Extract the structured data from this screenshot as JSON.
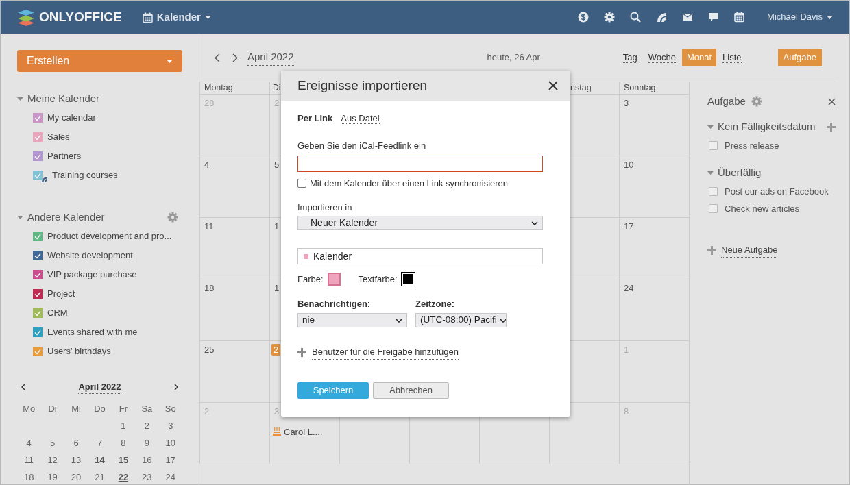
{
  "header": {
    "logo": "ONLYOFFICE",
    "module": "Kalender",
    "user": "Michael Davis"
  },
  "sidebar": {
    "create_button": "Erstellen",
    "sections": [
      {
        "title": "Meine Kalender",
        "expanded": true,
        "has_settings": false,
        "items": [
          {
            "label": "My calendar",
            "color": "#c994c7",
            "checked": true,
            "subscribed": false
          },
          {
            "label": "Sales",
            "color": "#e6a6bb",
            "checked": true,
            "subscribed": false
          },
          {
            "label": "Partners",
            "color": "#b396cf",
            "checked": true,
            "subscribed": false
          },
          {
            "label": "Training courses",
            "color": "#80c2d6",
            "checked": true,
            "subscribed": true
          }
        ]
      },
      {
        "title": "Andere Kalender",
        "expanded": true,
        "has_settings": true,
        "items": [
          {
            "label": "Product development and pro...",
            "color": "#5fb883",
            "checked": true,
            "subscribed": false
          },
          {
            "label": "Website development",
            "color": "#3f6899",
            "checked": true,
            "subscribed": false
          },
          {
            "label": "VIP package purchase",
            "color": "#cc4c90",
            "checked": true,
            "subscribed": false
          },
          {
            "label": "Project",
            "color": "#c02a50",
            "checked": true,
            "subscribed": false
          },
          {
            "label": "CRM",
            "color": "#a0bb5c",
            "checked": true,
            "subscribed": false
          },
          {
            "label": "Events shared with me",
            "color": "#2f9fc1",
            "checked": true,
            "subscribed": false
          },
          {
            "label": "Users' birthdays",
            "color": "#e89b3d",
            "checked": true,
            "subscribed": false
          }
        ]
      }
    ]
  },
  "mini_calendar": {
    "title": "April 2022",
    "weekdays": [
      "Mo",
      "Di",
      "Mi",
      "Do",
      "Fr",
      "Sa",
      "So"
    ],
    "weeks": [
      [
        {
          "day": "1",
          "has_events": false
        },
        {
          "day": "2",
          "has_events": false
        },
        {
          "day": "3",
          "has_events": false
        }
      ],
      [
        {
          "day": "4",
          "has_events": false
        },
        {
          "day": "5",
          "has_events": false
        },
        {
          "day": "6",
          "has_events": false
        },
        {
          "day": "7",
          "has_events": false
        },
        {
          "day": "8",
          "has_events": false
        },
        {
          "day": "9",
          "has_events": false
        },
        {
          "day": "10",
          "has_events": false
        }
      ],
      [
        {
          "day": "11",
          "has_events": false
        },
        {
          "day": "12",
          "has_events": false
        },
        {
          "day": "13",
          "has_events": false
        },
        {
          "day": "14",
          "has_events": true
        },
        {
          "day": "15",
          "has_events": true
        },
        {
          "day": "16",
          "has_events": false
        },
        {
          "day": "17",
          "has_events": false
        }
      ],
      [
        {
          "day": "18",
          "has_events": false
        },
        {
          "day": "19",
          "has_events": false
        },
        {
          "day": "20",
          "has_events": false
        },
        {
          "day": "21",
          "has_events": false
        },
        {
          "day": "22",
          "has_events": true
        },
        {
          "day": "23",
          "has_events": false
        },
        {
          "day": "24",
          "has_events": false
        }
      ]
    ]
  },
  "toolbar": {
    "period": "April 2022",
    "today": "heute, 26 Apr",
    "views": [
      {
        "label": "Tag",
        "selected": false
      },
      {
        "label": "Woche",
        "selected": false
      },
      {
        "label": "Monat",
        "selected": true
      },
      {
        "label": "Liste",
        "selected": false
      }
    ],
    "task_button": "Aufgabe"
  },
  "calendar": {
    "columns": [
      {
        "label": "Montag"
      },
      {
        "label": "Di"
      },
      {},
      {},
      {},
      {
        "label": "nstag"
      },
      {
        "label": "Sonntag"
      }
    ],
    "rows": [
      [
        {
          "day": "28",
          "other_month": true,
          "today": false
        },
        {
          "day": "2",
          "other_month": true,
          "today": false
        },
        {},
        {},
        {},
        {},
        {
          "day": "3",
          "other_month": false,
          "today": false
        }
      ],
      [
        {
          "day": "4",
          "other_month": false,
          "today": false
        },
        {
          "day": "5",
          "other_month": false,
          "today": false
        },
        {},
        {},
        {},
        {},
        {
          "day": "10",
          "other_month": false,
          "today": false
        }
      ],
      [
        {
          "day": "11",
          "other_month": false,
          "today": false
        },
        {
          "day": "1",
          "other_month": false,
          "today": false
        },
        {},
        {},
        {},
        {},
        {
          "day": "17",
          "other_month": false,
          "today": false
        }
      ],
      [
        {
          "day": "18",
          "other_month": false,
          "today": false
        },
        {
          "day": "1",
          "other_month": false,
          "today": false
        },
        {},
        {},
        {},
        {},
        {
          "day": "24",
          "other_month": false,
          "today": false
        }
      ],
      [
        {
          "day": "25",
          "other_month": false,
          "today": false
        },
        {
          "day": "2",
          "other_month": false,
          "today": true
        },
        {},
        {},
        {},
        {},
        {
          "day": "1",
          "other_month": true,
          "today": false
        }
      ],
      [
        {
          "day": "2",
          "other_month": true,
          "today": false
        },
        {
          "day": "3",
          "other_month": true,
          "today": false,
          "events": [
            {
              "title": "Carol L....",
              "kind": "birthday"
            }
          ]
        },
        {},
        {},
        {},
        {},
        {
          "day": "8",
          "other_month": true,
          "today": false
        }
      ]
    ]
  },
  "tasks": {
    "title": "Aufgabe",
    "groups": [
      {
        "title": "Kein Fälligkeitsdatum",
        "expanded": true,
        "can_add": true,
        "tasks": [
          {
            "label": "Press release",
            "checked": false
          }
        ]
      },
      {
        "title": "Überfällig",
        "expanded": true,
        "can_add": false,
        "tasks": [
          {
            "label": "Post our ads on Facebook",
            "checked": false
          },
          {
            "label": "Check new articles",
            "checked": false
          }
        ]
      }
    ],
    "new_task": "Neue Aufgabe"
  },
  "dialog": {
    "title": "Ereignisse importieren",
    "tabs": [
      {
        "label": "Per Link",
        "selected": true
      },
      {
        "label": "Aus Datei",
        "selected": false
      }
    ],
    "url_label": "Geben Sie den iCal-Feedlink ein",
    "url_field": {
      "focused": true
    },
    "sync": {
      "label": "Mit dem Kalender über einen Link synchronisieren",
      "checked": false
    },
    "import_into": {
      "label": "Importieren in",
      "value": "Neuer Kalender"
    },
    "calendar_name": {
      "value": "Kalender",
      "color": "#f0a3bc"
    },
    "fill": {
      "label": "Farbe:",
      "color": "#f0a3bc"
    },
    "text_color": {
      "label": "Textfarbe:",
      "color": "#000000"
    },
    "notify": {
      "label": "Benachrichtigen:",
      "value": "nie"
    },
    "timezone": {
      "label": "Zeitzone:",
      "value": "(UTC-08:00) Pacifi"
    },
    "share_link": "Benutzer für die Freigabe hinzufügen",
    "buttons": [
      {
        "label": "Speichern",
        "kind": "primary"
      },
      {
        "label": "Abbrechen",
        "kind": "secondary"
      }
    ]
  }
}
